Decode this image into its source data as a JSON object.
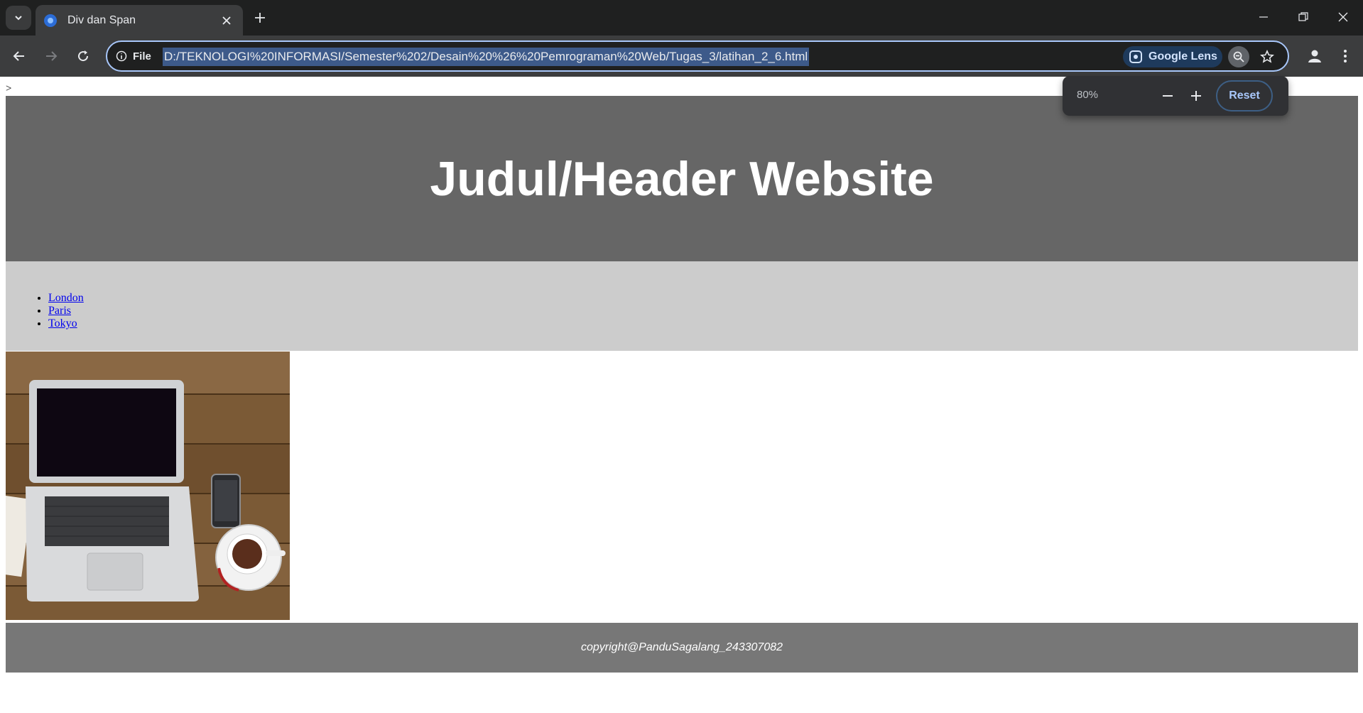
{
  "browser": {
    "tab": {
      "title": "Div dan Span"
    },
    "address_bar": {
      "site_info_label": "File",
      "url": "D:/TEKNOLOGI%20INFORMASI/Semester%202/Desain%20%26%20Pemrograman%20Web/Tugas_3/latihan_2_6.html"
    },
    "lens": {
      "label": "Google Lens"
    },
    "zoom_bubble": {
      "level": "80%",
      "reset_label": "Reset"
    }
  },
  "page": {
    "stray_text": ">",
    "header": {
      "title": "Judul/Header Website"
    },
    "nav": {
      "links": [
        {
          "label": "London"
        },
        {
          "label": "Paris"
        },
        {
          "label": "Tokyo"
        }
      ]
    },
    "image": {
      "subject": "laptop-and-coffee-photo"
    },
    "footer": {
      "text": "copyright@PanduSagalang_243307082"
    }
  },
  "colors": {
    "header_bg": "#666666",
    "nav_bg": "#cccccc",
    "footer_bg": "#777777",
    "link": "#0000ee"
  }
}
